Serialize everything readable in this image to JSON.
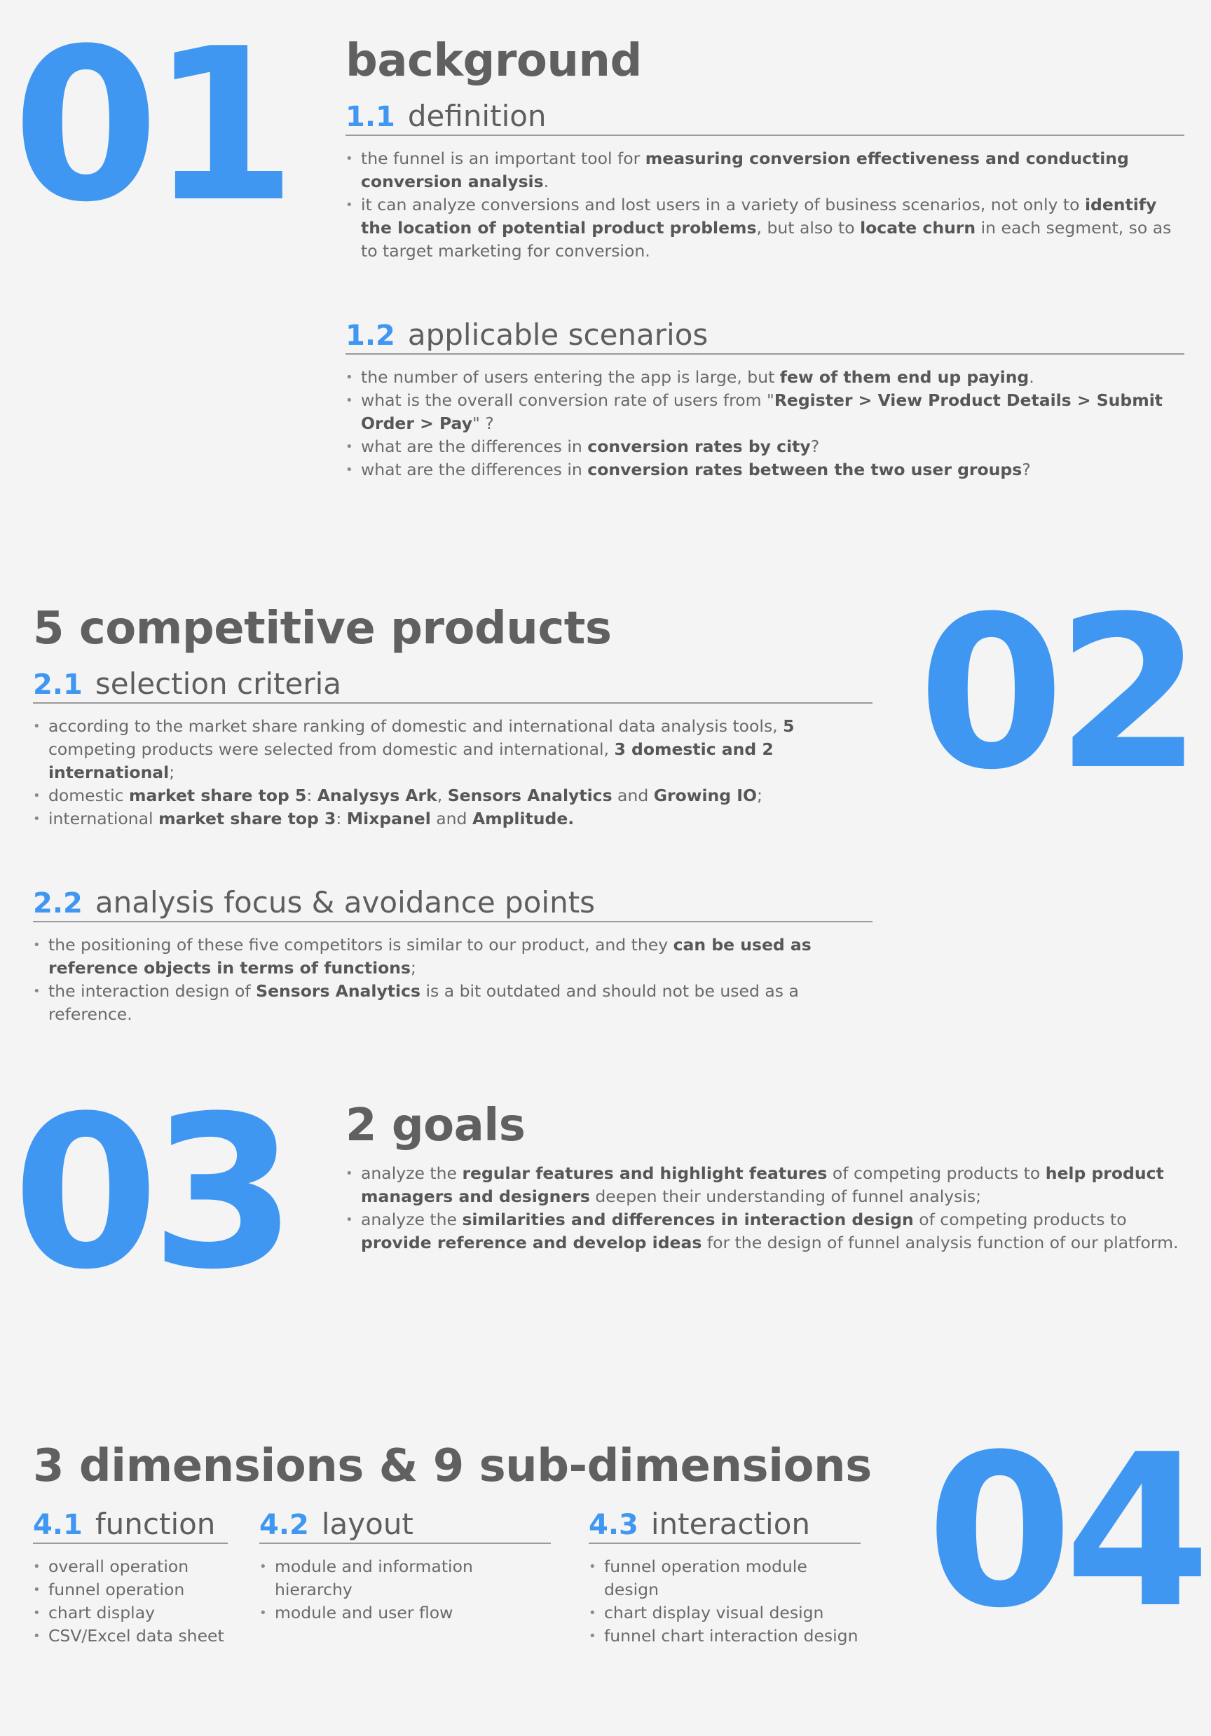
{
  "section1": {
    "number": "01",
    "title": "background",
    "sub1": {
      "num": "1.1",
      "label": "definition",
      "bullets": [
        [
          {
            "t": "the funnel is an important tool for "
          },
          {
            "t": "measuring conversion effectiveness and conducting conversion analysis",
            "b": true
          },
          {
            "t": "."
          }
        ],
        [
          {
            "t": "it can analyze conversions and lost users in a variety of business scenarios, not only to "
          },
          {
            "t": "identify the location of potential product problems",
            "b": true
          },
          {
            "t": ", but also to "
          },
          {
            "t": "locate churn",
            "b": true
          },
          {
            "t": " in each segment, so as to target marketing for conversion."
          }
        ]
      ]
    },
    "sub2": {
      "num": "1.2",
      "label": "applicable scenarios",
      "bullets": [
        [
          {
            "t": "the number of users entering the app is large, but "
          },
          {
            "t": "few of them end up paying",
            "b": true
          },
          {
            "t": "."
          }
        ],
        [
          {
            "t": "what is the overall conversion rate of users from \""
          },
          {
            "t": "Register > View Product Details > Submit Order > Pay",
            "b": true
          },
          {
            "t": "\" ?"
          }
        ],
        [
          {
            "t": "what are the differences in "
          },
          {
            "t": "conversion rates by city",
            "b": true
          },
          {
            "t": "?"
          }
        ],
        [
          {
            "t": "what are the differences in "
          },
          {
            "t": "conversion rates between the two user groups",
            "b": true
          },
          {
            "t": "?"
          }
        ]
      ]
    }
  },
  "section2": {
    "number": "02",
    "title": "5 competitive products",
    "sub1": {
      "num": "2.1",
      "label": "selection criteria",
      "bullets": [
        [
          {
            "t": "according to the market share ranking of domestic and international data analysis tools, "
          },
          {
            "t": "5",
            "b": true
          },
          {
            "t": " competing products were selected from domestic and international, "
          },
          {
            "t": "3 domestic and 2 international",
            "b": true
          },
          {
            "t": ";"
          }
        ],
        [
          {
            "t": "domestic "
          },
          {
            "t": "market share top 5",
            "b": true
          },
          {
            "t": ": "
          },
          {
            "t": "Analysys Ark",
            "b": true
          },
          {
            "t": ", "
          },
          {
            "t": "Sensors Analytics",
            "b": true
          },
          {
            "t": " and "
          },
          {
            "t": "Growing IO",
            "b": true
          },
          {
            "t": ";"
          }
        ],
        [
          {
            "t": "international "
          },
          {
            "t": "market share top 3",
            "b": true
          },
          {
            "t": ": "
          },
          {
            "t": "Mixpanel",
            "b": true
          },
          {
            "t": " and "
          },
          {
            "t": "Amplitude.",
            "b": true
          }
        ]
      ]
    },
    "sub2": {
      "num": "2.2",
      "label": "analysis focus & avoidance points",
      "bullets": [
        [
          {
            "t": "the positioning of these five competitors is similar to our product, and they "
          },
          {
            "t": "can be used as reference objects in terms of functions",
            "b": true
          },
          {
            "t": ";"
          }
        ],
        [
          {
            "t": "the interaction design of "
          },
          {
            "t": "Sensors Analytics",
            "b": true
          },
          {
            "t": " is a bit outdated and should not be used as a reference."
          }
        ]
      ]
    }
  },
  "section3": {
    "number": "03",
    "title": "2 goals",
    "bullets": [
      [
        {
          "t": "analyze the "
        },
        {
          "t": "regular features and highlight features",
          "b": true
        },
        {
          "t": " of competing products to "
        },
        {
          "t": "help product managers and designers",
          "b": true
        },
        {
          "t": " deepen their understanding of funnel analysis;"
        }
      ],
      [
        {
          "t": "analyze the "
        },
        {
          "t": "similarities and differences in interaction design",
          "b": true
        },
        {
          "t": " of competing products to "
        },
        {
          "t": "provide reference and develop ideas",
          "b": true
        },
        {
          "t": " for the design of funnel analysis function of our platform."
        }
      ]
    ]
  },
  "section4": {
    "number": "04",
    "title": "3 dimensions & 9 sub-dimensions",
    "columns": [
      {
        "num": "4.1",
        "label": "function",
        "items": [
          "overall operation",
          "funnel operation",
          "chart display",
          "CSV/Excel data sheet"
        ]
      },
      {
        "num": "4.2",
        "label": "layout",
        "items": [
          "module and information hierarchy",
          "module and user flow"
        ]
      },
      {
        "num": "4.3",
        "label": "interaction",
        "items": [
          "funnel operation module design",
          "chart display visual design",
          "funnel chart interaction design"
        ]
      }
    ]
  }
}
